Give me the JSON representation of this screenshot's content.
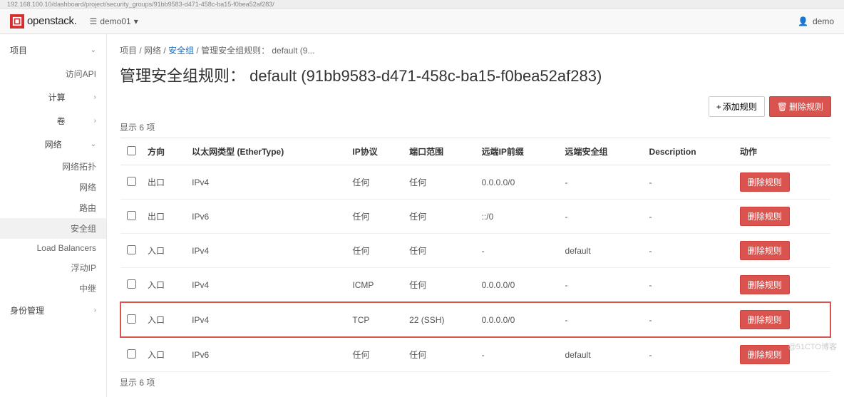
{
  "url_fragment": "192.168.100.10/dashboard/project/security_groups/91bb9583-d471-458c-ba15-f0bea52af283/",
  "brand": "openstack.",
  "project_selector": "demo01",
  "user_menu": "demo",
  "sidebar": {
    "project": "项目",
    "access_api": "访问API",
    "compute": "计算",
    "volumes": "卷",
    "network": "网络",
    "network_topology": "网络拓扑",
    "networks": "网络",
    "routers": "路由",
    "security_groups": "安全组",
    "load_balancers": "Load Balancers",
    "floating_ips": "浮动IP",
    "trunks": "中继",
    "identity": "身份管理"
  },
  "breadcrumb": {
    "item1": "项目",
    "item2": "网络",
    "item3": "安全组",
    "item4": "管理安全组规则： default (9..."
  },
  "page_title": "管理安全组规则： default (91bb9583-d471-458c-ba15-f0bea52af283)",
  "actions": {
    "add_rule": "添加规则",
    "delete_rules": "删除规则"
  },
  "count_text": "显示 6 项",
  "columns": {
    "direction": "方向",
    "ether_type": "以太网类型 (EtherType)",
    "ip_protocol": "IP协议",
    "port_range": "端口范围",
    "remote_ip_prefix": "远端IP前缀",
    "remote_sg": "远端安全组",
    "description": "Description",
    "actions": "动作"
  },
  "row_action_label": "删除规则",
  "rows": [
    {
      "dir": "出口",
      "eth": "IPv4",
      "proto": "任何",
      "port": "任何",
      "prefix": "0.0.0.0/0",
      "sg": "-",
      "desc": "-",
      "hl": false
    },
    {
      "dir": "出口",
      "eth": "IPv6",
      "proto": "任何",
      "port": "任何",
      "prefix": "::/0",
      "sg": "-",
      "desc": "-",
      "hl": false
    },
    {
      "dir": "入口",
      "eth": "IPv4",
      "proto": "任何",
      "port": "任何",
      "prefix": "-",
      "sg": "default",
      "desc": "-",
      "hl": false
    },
    {
      "dir": "入口",
      "eth": "IPv4",
      "proto": "ICMP",
      "port": "任何",
      "prefix": "0.0.0.0/0",
      "sg": "-",
      "desc": "-",
      "hl": false
    },
    {
      "dir": "入口",
      "eth": "IPv4",
      "proto": "TCP",
      "port": "22 (SSH)",
      "prefix": "0.0.0.0/0",
      "sg": "-",
      "desc": "-",
      "hl": true
    },
    {
      "dir": "入口",
      "eth": "IPv6",
      "proto": "任何",
      "port": "任何",
      "prefix": "-",
      "sg": "default",
      "desc": "-",
      "hl": false
    }
  ],
  "watermark": "@51CTO博客"
}
